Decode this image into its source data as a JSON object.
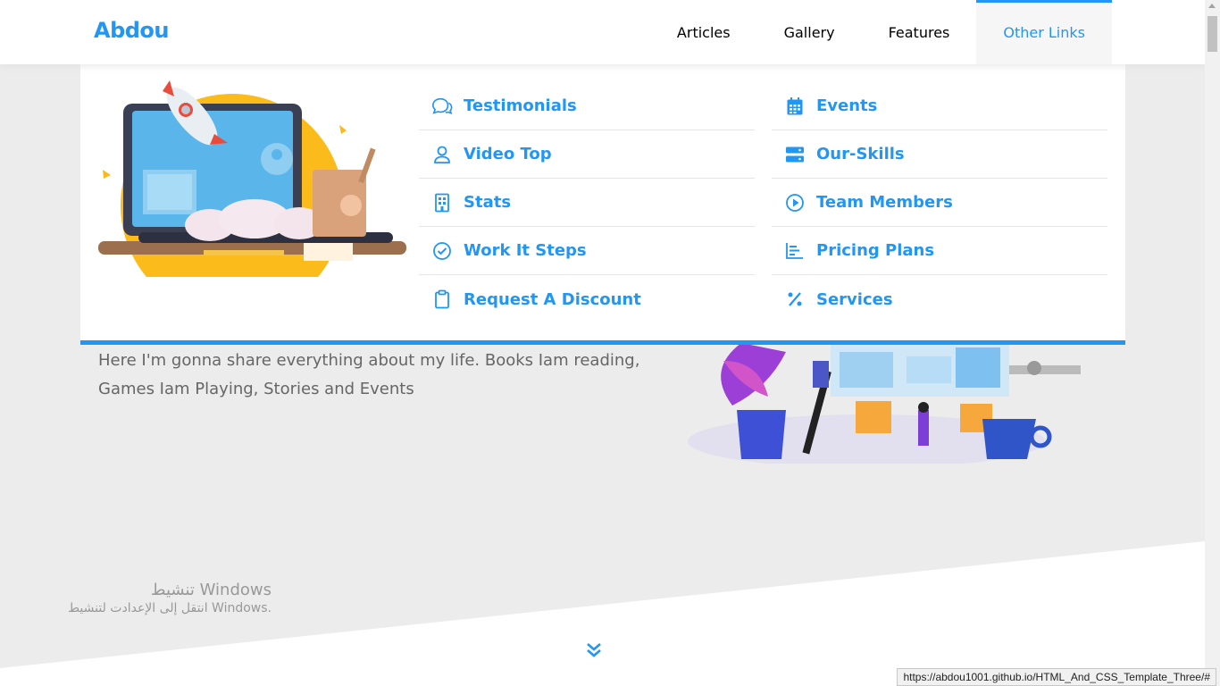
{
  "header": {
    "logo": "Abdou",
    "nav": [
      {
        "label": "Articles"
      },
      {
        "label": "Gallery"
      },
      {
        "label": "Features"
      },
      {
        "label": "Other Links"
      }
    ]
  },
  "mega_menu": {
    "col1": [
      {
        "label": "Testimonials",
        "icon": "comments-icon"
      },
      {
        "label": "Video Top",
        "icon": "user-icon"
      },
      {
        "label": "Stats",
        "icon": "building-icon"
      },
      {
        "label": "Work It Steps",
        "icon": "check-circle-icon"
      },
      {
        "label": "Request A Discount",
        "icon": "clipboard-icon"
      }
    ],
    "col2": [
      {
        "label": "Events",
        "icon": "calendar-icon"
      },
      {
        "label": "Our-Skills",
        "icon": "server-icon"
      },
      {
        "label": "Team Members",
        "icon": "play-circle-icon"
      },
      {
        "label": "Pricing Plans",
        "icon": "chart-icon"
      },
      {
        "label": "Services",
        "icon": "percent-icon"
      }
    ]
  },
  "hero": {
    "text": "Here I'm gonna share everything about my life. Books Iam reading, Games Iam Playing, Stories and Events"
  },
  "watermark": {
    "line1": "تنشيط Windows",
    "line2": "انتقل إلى الإعدادت لتنشيط Windows."
  },
  "status_url": "https://abdou1001.github.io/HTML_And_CSS_Template_Three/#",
  "colors": {
    "accent": "#2196f3",
    "background": "#ececec"
  }
}
